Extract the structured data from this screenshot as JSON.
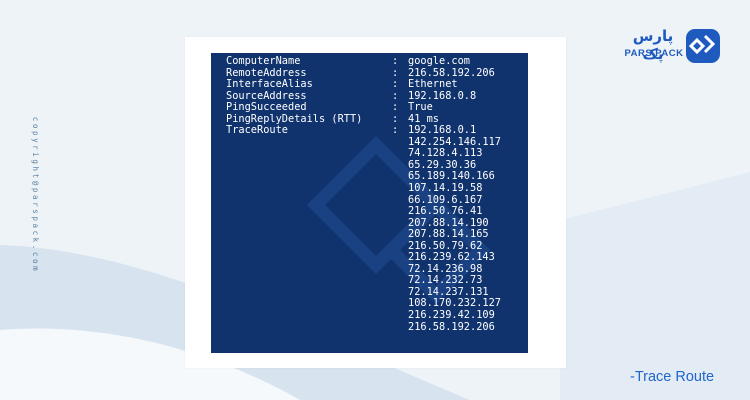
{
  "brand": {
    "name_fa": "پارس پک",
    "name_en": "PARS PACK",
    "primary_color": "#1f5bbf"
  },
  "copyright": "copyright@parspack.com",
  "caption": "-Trace Route",
  "terminal": {
    "background": "#10326d",
    "text_color": "#ffffff",
    "fields": [
      {
        "key": "ComputerName",
        "sep": ":",
        "value": "google.com"
      },
      {
        "key": "RemoteAddress",
        "sep": ":",
        "value": "216.58.192.206"
      },
      {
        "key": "InterfaceAlias",
        "sep": ":",
        "value": "Ethernet"
      },
      {
        "key": "SourceAddress",
        "sep": ":",
        "value": "192.168.0.8"
      },
      {
        "key": "PingSucceeded",
        "sep": ":",
        "value": "True"
      },
      {
        "key": "PingReplyDetails (RTT)",
        "sep": ":",
        "value": "41 ms"
      },
      {
        "key": "TraceRoute",
        "sep": ":",
        "value": "192.168.0.1"
      }
    ],
    "trace_hops": [
      "142.254.146.117",
      "74.128.4.113",
      "65.29.30.36",
      "65.189.140.166",
      "107.14.19.58",
      "66.109.6.167",
      "216.50.76.41",
      "207.88.14.190",
      "207.88.14.165",
      "216.50.79.62",
      "216.239.62.143",
      "72.14.236.98",
      "72.14.232.73",
      "72.14.237.131",
      "108.170.232.127",
      "216.239.42.109",
      "216.58.192.206"
    ]
  }
}
